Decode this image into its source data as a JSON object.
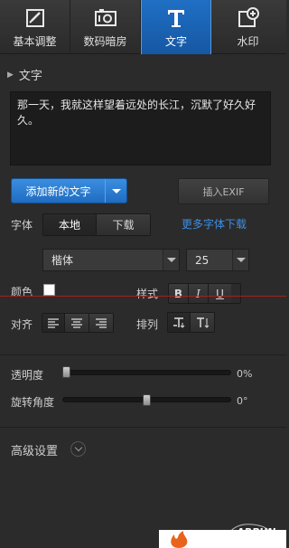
{
  "tabs": [
    {
      "label": "基本调整",
      "icon": "crop-adjust-icon",
      "active": false
    },
    {
      "label": "数码暗房",
      "icon": "film-darkroom-icon",
      "active": false
    },
    {
      "label": "文字",
      "icon": "text-t-icon",
      "active": true
    },
    {
      "label": "水印",
      "icon": "watermark-add-icon",
      "active": false
    }
  ],
  "text_section": {
    "title": "文字",
    "content": "那一天，我就这样望着远处的长江，沉默了好久好久。"
  },
  "buttons": {
    "add_text": "添加新的文字",
    "insert_exif": "插入EXIF"
  },
  "font": {
    "label": "字体",
    "source_local": "本地",
    "source_download": "下载",
    "more_fonts_link": "更多字体下载",
    "family": "楷体",
    "size": "25"
  },
  "color": {
    "label": "颜色",
    "value": "#ffffff"
  },
  "style": {
    "label": "样式",
    "bold": "B",
    "italic": "I",
    "underline": "U"
  },
  "align": {
    "label": "对齐"
  },
  "arrange": {
    "label": "排列"
  },
  "opacity": {
    "label": "透明度",
    "value_text": "0%",
    "value": 0
  },
  "rotation": {
    "label": "旋转角度",
    "value_text": "0°",
    "value": 0.5
  },
  "advanced": {
    "label": "高级设置"
  },
  "watermark": {
    "text": "ARPUN"
  },
  "colors": {
    "accent": "#1f6cc0",
    "link": "#3d8fe6",
    "background": "#2b2b2b"
  }
}
